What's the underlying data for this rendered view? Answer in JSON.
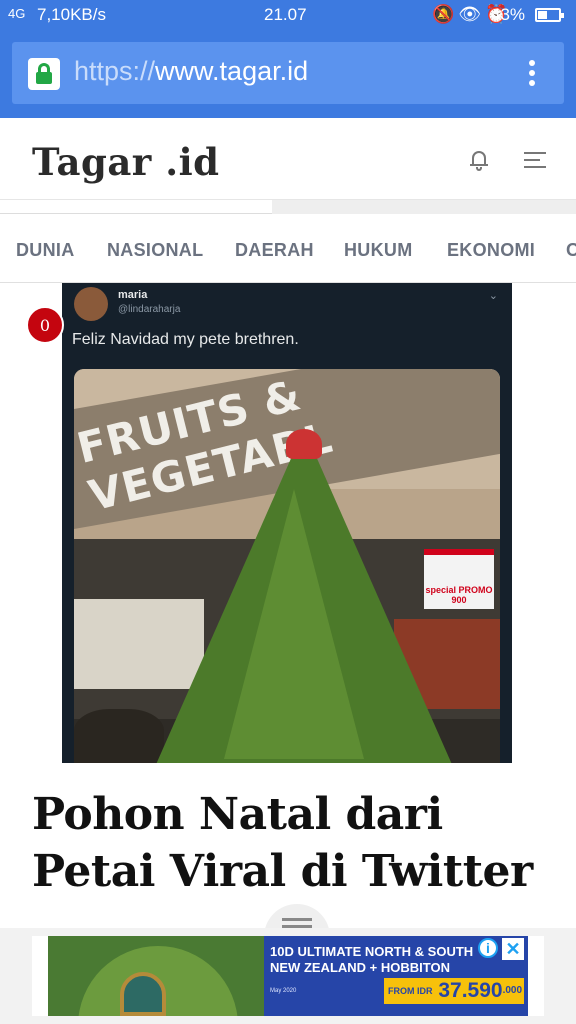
{
  "status_bar": {
    "signal": "4G",
    "speed": "7,10KB/s",
    "time": "21.07",
    "icons": [
      "bell-muted-icon",
      "eye-icon",
      "alarm-icon"
    ],
    "battery": "43%"
  },
  "browser": {
    "url_scheme": "https://",
    "url_host": "www.tagar.id",
    "lock_color": "#22a745",
    "toolbar_color": "#3d7ae0"
  },
  "site": {
    "logo": "Tagar",
    "logo_suffix": ".id",
    "accent_color": "#d0021b"
  },
  "categories": [
    "DUNIA",
    "NASIONAL",
    "DAERAH",
    "HUKUM",
    "EKONOMI",
    "O"
  ],
  "tweet": {
    "name": "maria",
    "handle": "@lindaraharja",
    "text": "Feliz Navidad my pete brethren.",
    "photo_sign": "FRUITS & VEGETABL",
    "promo_label": "special PROMO",
    "promo_price": "900"
  },
  "article": {
    "comment_count": "0",
    "headline": "Pohon Natal dari Petai Viral di Twitter"
  },
  "ad": {
    "line1": "10D ULTIMATE NORTH & SOUTH",
    "line2": "NEW ZEALAND + HOBBITON",
    "date": "May 2020",
    "price_from": "FROM IDR",
    "price": "37.590",
    "price_decimals": ".000",
    "info_label": "i",
    "close_label": "✕"
  }
}
